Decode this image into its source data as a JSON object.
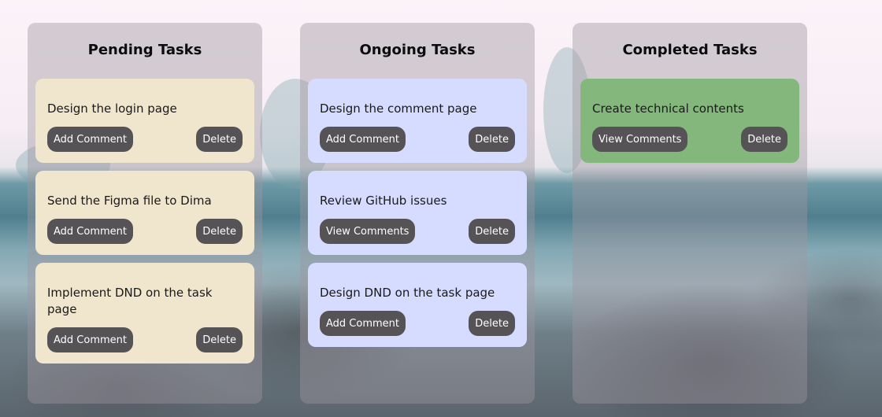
{
  "columns": [
    {
      "title": "Pending Tasks",
      "variant": "pending",
      "tasks": [
        {
          "text": "Design the login page",
          "comment_label": "Add Comment",
          "delete_label": "Delete"
        },
        {
          "text": "Send the Figma file to Dima",
          "comment_label": "Add Comment",
          "delete_label": "Delete"
        },
        {
          "text": "Implement DND on the task page",
          "comment_label": "Add Comment",
          "delete_label": "Delete"
        }
      ]
    },
    {
      "title": "Ongoing Tasks",
      "variant": "ongoing",
      "tasks": [
        {
          "text": "Design the comment page",
          "comment_label": "Add Comment",
          "delete_label": "Delete"
        },
        {
          "text": "Review GitHub issues",
          "comment_label": "View Comments",
          "delete_label": "Delete"
        },
        {
          "text": "Design DND on the task page",
          "comment_label": "Add Comment",
          "delete_label": "Delete"
        }
      ]
    },
    {
      "title": "Completed Tasks",
      "variant": "completed",
      "tasks": [
        {
          "text": "Create technical contents",
          "comment_label": "View Comments",
          "delete_label": "Delete"
        }
      ]
    }
  ],
  "colors": {
    "pending_card": "#f0e5cd",
    "ongoing_card": "#d5dcff",
    "completed_card": "#83b77b",
    "button": "#555355"
  }
}
